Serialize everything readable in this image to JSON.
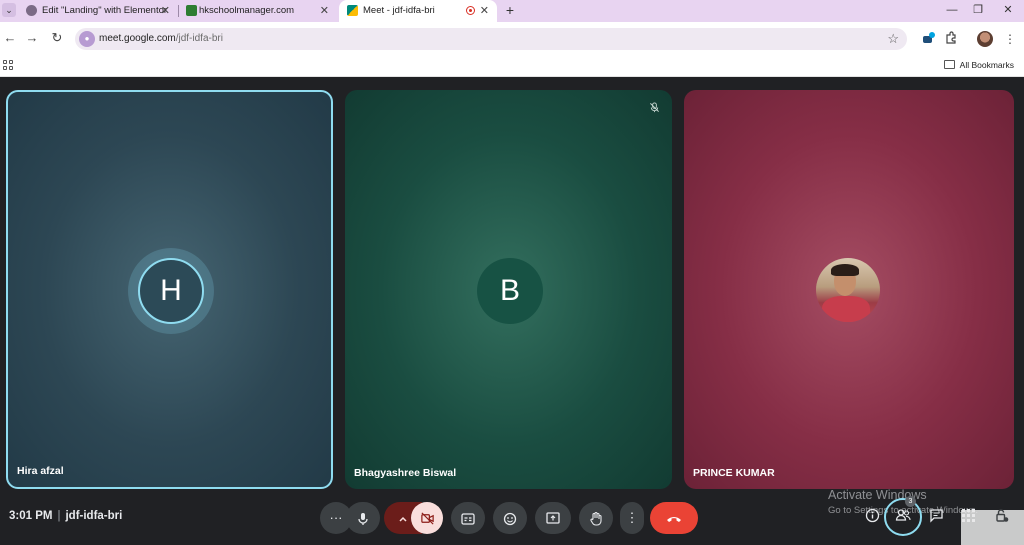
{
  "browser": {
    "tabs": [
      {
        "title": "Edit \"Landing\" with Elementor",
        "favicon_color": "#7b6b86"
      },
      {
        "title": "hkschoolmanager.com",
        "favicon_color": "#2e7d32"
      },
      {
        "title": "Meet - jdf-idfa-bri",
        "favicon_color": "#00897b",
        "active": true,
        "recording": true
      }
    ],
    "url_host": "meet.google.com",
    "url_path": "/jdf-idfa-bri",
    "bookmarks_label": "All Bookmarks"
  },
  "meet": {
    "participants": [
      {
        "name": "Hira afzal",
        "initial": "H",
        "speaking": true,
        "color": "#2c4a57"
      },
      {
        "name": "Bhagyashree Biswal",
        "initial": "B",
        "muted": true,
        "color": "#175244"
      },
      {
        "name": "PRINCE KUMAR",
        "has_photo": true,
        "color": "#862e46"
      }
    ],
    "time": "3:01 PM",
    "meeting_code": "jdf-idfa-bri",
    "people_count": "3",
    "controls": [
      "more-options",
      "microphone",
      "camera-options",
      "camera-off",
      "captions",
      "reactions",
      "present",
      "raise-hand",
      "more-actions",
      "leave-call"
    ],
    "right_controls": [
      "meeting-details",
      "people",
      "chat",
      "activities",
      "host-controls"
    ]
  },
  "watermark": {
    "line1": "Activate Windows",
    "line2": "Go to Settings to activate Windows."
  },
  "colors": {
    "accent_ring": "#8fdcf0",
    "leave": "#ea4335",
    "control_bg": "#3c4043"
  }
}
